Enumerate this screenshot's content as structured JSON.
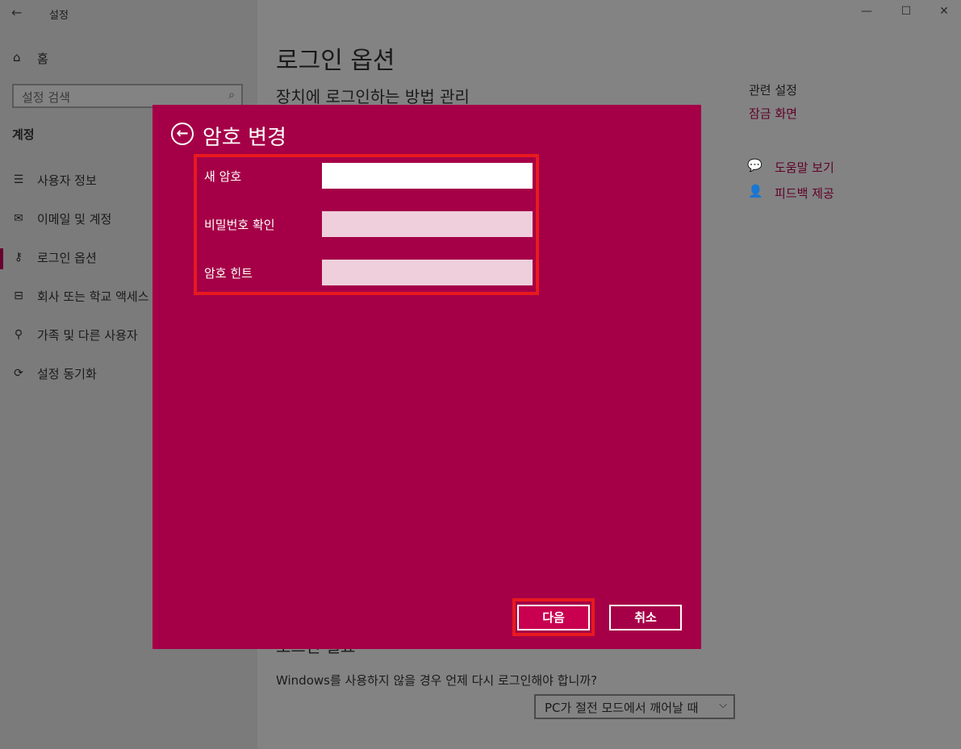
{
  "window": {
    "title": "설정",
    "back_glyph": "←",
    "controls": {
      "minimize": "—",
      "maximize": "☐",
      "close": "✕"
    }
  },
  "sidebar": {
    "home_label": "홈",
    "search_placeholder": "설정 검색",
    "section_title": "계정",
    "items": [
      {
        "label": "사용자 정보",
        "icon": "user-info-icon",
        "glyph": "☰"
      },
      {
        "label": "이메일 및 계정",
        "icon": "mail-icon",
        "glyph": "✉"
      },
      {
        "label": "로그인 옵션",
        "icon": "key-icon",
        "glyph": "⚷"
      },
      {
        "label": "회사 또는 학교 액세스",
        "icon": "briefcase-icon",
        "glyph": "⊟"
      },
      {
        "label": "가족 및 다른 사용자",
        "icon": "person-add-icon",
        "glyph": "⚲"
      },
      {
        "label": "설정 동기화",
        "icon": "sync-icon",
        "glyph": "⟳"
      }
    ],
    "selected_index": 2
  },
  "main": {
    "page_title": "로그인 옵션",
    "subtitle": "장치에 로그인하는 방법 관리",
    "hidden_section_heading": "로그인 필요",
    "signin_question": "Windows를 사용하지 않을 경우 언제 다시 로그인해야 합니까?",
    "signin_dropdown_value": "PC가 절전 모드에서 깨어날 때"
  },
  "related": {
    "heading": "관련 설정",
    "lock_screen_link": "잠금 화면",
    "help_link": "도움말 보기",
    "feedback_link": "피드백 제공"
  },
  "dialog": {
    "title": "암호 변경",
    "fields": [
      {
        "label": "새 암호",
        "value": ""
      },
      {
        "label": "비밀번호 확인",
        "value": ""
      },
      {
        "label": "암호 힌트",
        "value": ""
      }
    ],
    "next_button": "다음",
    "cancel_button": "취소"
  },
  "colors": {
    "dialog_bg": "#a50047",
    "highlight": "#e8191f",
    "accent_link": "#5f0028"
  }
}
